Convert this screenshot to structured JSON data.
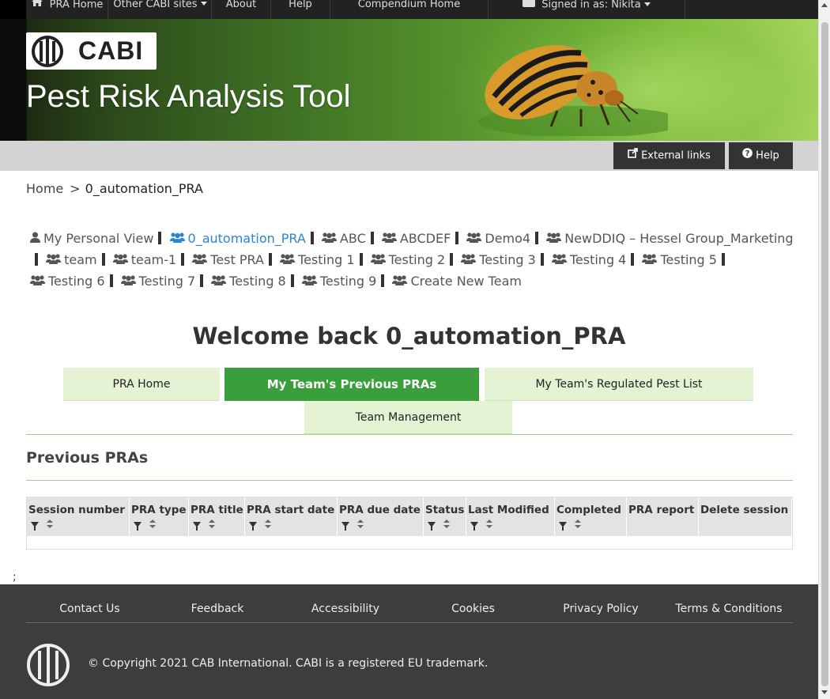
{
  "nav": {
    "items": [
      {
        "label": "PRA Home",
        "icon": "home-icon"
      },
      {
        "label": "Other CABI sites",
        "dropdown": true
      },
      {
        "label": "About"
      },
      {
        "label": "Help"
      },
      {
        "label": "Compendium Home"
      },
      {
        "label": "Signed in as: Nikita",
        "icon": "user-icon",
        "dropdown": true
      }
    ]
  },
  "banner": {
    "logo_text": "CABI",
    "title": "Pest Risk Analysis Tool"
  },
  "toolbar": {
    "external_links": "External links",
    "help": "Help"
  },
  "breadcrumb": {
    "home": "Home",
    "separator": ">",
    "current": "0_automation_PRA"
  },
  "teams": [
    {
      "label": "My Personal View",
      "icon": "user-icon"
    },
    {
      "label": "0_automation_PRA",
      "icon": "users-icon",
      "active": true
    },
    {
      "label": "ABC",
      "icon": "users-icon"
    },
    {
      "label": "ABCDEF",
      "icon": "users-icon"
    },
    {
      "label": "Demo4",
      "icon": "users-icon"
    },
    {
      "label": "NewDDIQ – Hessel Group_Marketing",
      "icon": "users-icon"
    },
    {
      "label": "team",
      "icon": "users-icon"
    },
    {
      "label": "team-1",
      "icon": "users-icon"
    },
    {
      "label": "Test PRA",
      "icon": "users-icon"
    },
    {
      "label": "Testing 1",
      "icon": "users-icon"
    },
    {
      "label": "Testing 2",
      "icon": "users-icon"
    },
    {
      "label": "Testing 3",
      "icon": "users-icon"
    },
    {
      "label": "Testing 4",
      "icon": "users-icon"
    },
    {
      "label": "Testing 5",
      "icon": "users-icon"
    },
    {
      "label": "Testing 6",
      "icon": "users-icon"
    },
    {
      "label": "Testing 7",
      "icon": "users-icon"
    },
    {
      "label": "Testing 8",
      "icon": "users-icon"
    },
    {
      "label": "Testing 9",
      "icon": "users-icon"
    },
    {
      "label": "Create New Team",
      "icon": "users-icon"
    }
  ],
  "welcome": "Welcome back 0_automation_PRA",
  "tabs": [
    {
      "label": "PRA Home"
    },
    {
      "label": "My Team's Previous PRAs",
      "active": true
    },
    {
      "label": "My Team's Regulated Pest List"
    },
    {
      "label": "Team Management"
    }
  ],
  "section_title": "Previous PRAs",
  "table": {
    "columns": [
      {
        "label": "Session number",
        "filter": true,
        "sort": true
      },
      {
        "label": "PRA type",
        "filter": true,
        "sort": true
      },
      {
        "label": "PRA title",
        "filter": true,
        "sort": true
      },
      {
        "label": "PRA start date",
        "filter": true,
        "sort": true
      },
      {
        "label": "PRA due date",
        "filter": true,
        "sort": true
      },
      {
        "label": "Status",
        "filter": true,
        "sort": true
      },
      {
        "label": "Last Modified",
        "filter": true,
        "sort": true
      },
      {
        "label": "Completed",
        "filter": true,
        "sort": true
      },
      {
        "label": "PRA report",
        "filter": false,
        "sort": false
      },
      {
        "label": "Delete session",
        "filter": false,
        "sort": false
      }
    ],
    "rows": []
  },
  "stray_text": ";",
  "footer": {
    "links": [
      "Contact Us",
      "Feedback",
      "Accessibility",
      "Cookies",
      "Privacy Policy",
      "Terms & Conditions"
    ],
    "copyright": "© Copyright 2021 CAB International. CABI is a registered EU trademark."
  },
  "colors": {
    "accent_green": "#3a9f3a",
    "tab_light_green": "#e4f3d4",
    "link_blue": "#2a85d0",
    "footer_bg": "#3d3d3d",
    "nav_bg": "#222222"
  }
}
